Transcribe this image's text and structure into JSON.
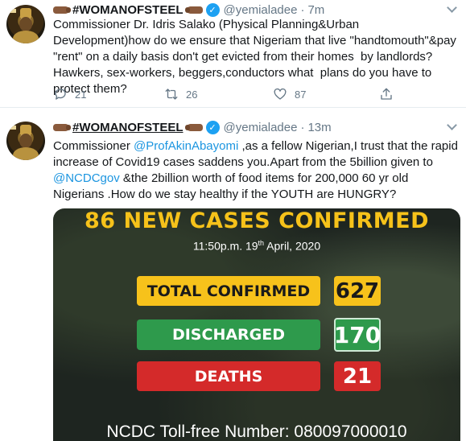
{
  "tweets": [
    {
      "name": "#WOMANOFSTEEL",
      "handle": "@yemialadee",
      "separator": "·",
      "time": "7m",
      "text": "Commissioner Dr. Idris Salako (Physical Planning&Urban Development)how do we ensure that Nigeriam that live \"handtomouth\"&pay \"rent\" on a daily basis don't get evicted from their homes  by landlords?Hawkers, sex-workers, beggers,conductors what  plans do you have to protect them?",
      "reply_count": "21",
      "retweet_count": "26",
      "like_count": "87"
    },
    {
      "name": "#WOMANOFSTEEL",
      "handle": "@yemialadee",
      "separator": "·",
      "time": "13m",
      "text_parts": {
        "p1": "Commissioner ",
        "mention1": "@ProfAkinAbayomi",
        "p2": " ,as a fellow Nigerian,I trust that the rapid increase of Covid19 cases saddens you.Apart from the 5billion given to ",
        "mention2": "@NCDCgov",
        "p3": " &the 2billion worth of food items for 200,000 60 yr old Nigerians .How do we stay healthy if the YOUTH are HUNGRY?"
      },
      "media": {
        "title": "86 NEW CASES CONFIRMED",
        "date_pre": "11:50p.m. 19",
        "date_sup": "th",
        "date_post": " April, 2020",
        "total_label": "TOTAL CONFIRMED",
        "total_value": "627",
        "discharged_label": "DISCHARGED",
        "discharged_value": "170",
        "deaths_label": "DEATHS",
        "deaths_value": "21",
        "tollfree": "NCDC Toll-free Number: 080097000010"
      }
    }
  ],
  "colors": {
    "accent": "#1b95e0",
    "verified": "#1da1f2",
    "muted": "#657786",
    "title_yellow": "#f6c21a",
    "discharged_green": "#2e9a4c",
    "deaths_red": "#d42a2a"
  },
  "icons": [
    "reply-icon",
    "retweet-icon",
    "like-icon",
    "share-icon",
    "verified-badge-icon",
    "chevron-down-icon",
    "raised-fist-emoji"
  ]
}
